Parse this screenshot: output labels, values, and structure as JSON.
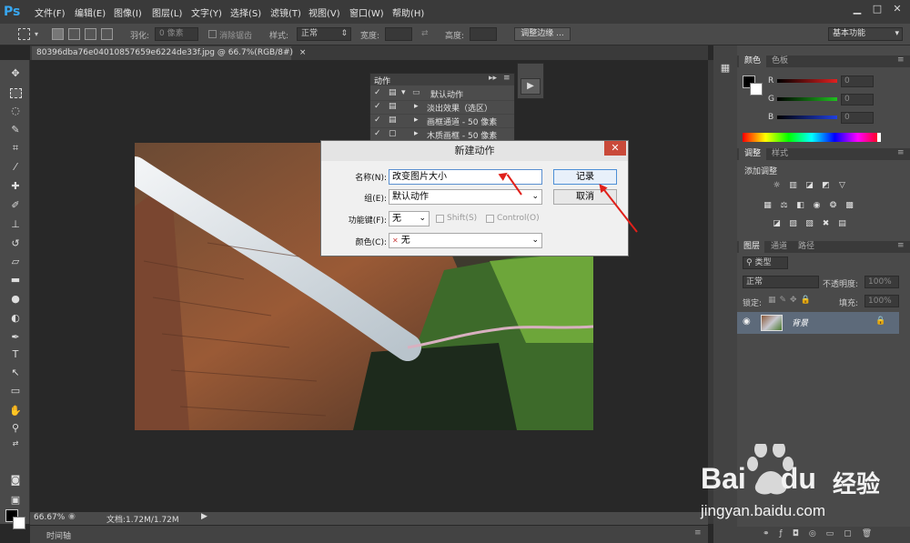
{
  "menubar": {
    "logo": "Ps",
    "items": [
      "文件(F)",
      "编辑(E)",
      "图像(I)",
      "图层(L)",
      "文字(Y)",
      "选择(S)",
      "滤镜(T)",
      "视图(V)",
      "窗口(W)",
      "帮助(H)"
    ]
  },
  "options": {
    "feather_label": "羽化:",
    "feather_value": "0 像素",
    "antialias_label": "消除锯齿",
    "style_label": "样式:",
    "style_value": "正常",
    "width_label": "宽度:",
    "height_label": "高度:",
    "refine_button": "调整边缘 ...",
    "workspace": "基本功能"
  },
  "document": {
    "tab_title": "80396dba76e04010857659e6224de33f.jpg @ 66.7%(RGB/8#)",
    "close": "×"
  },
  "status": {
    "zoom": "66.67%",
    "doc_info": "文档:1.72M/1.72M"
  },
  "timeline": {
    "label": "时间轴"
  },
  "actions_panel": {
    "title": "动作",
    "rows": [
      {
        "label": "默认动作",
        "type": "set"
      },
      {
        "label": "淡出效果（选区）",
        "type": "action"
      },
      {
        "label": "画框通道 - 50 像素",
        "type": "action"
      },
      {
        "label": "木质画框 - 50 像素",
        "type": "action"
      }
    ]
  },
  "dialog": {
    "title": "新建动作",
    "close": "✕",
    "name_label": "名称(N):",
    "name_value": "改变图片大小",
    "group_label": "组(E):",
    "group_value": "默认动作",
    "fkey_label": "功能键(F):",
    "fkey_value": "无",
    "shift_label": "Shift(S)",
    "control_label": "Control(O)",
    "color_label": "颜色(C):",
    "color_value": "无",
    "record_button": "记录",
    "cancel_button": "取消"
  },
  "color_panel": {
    "tabs": [
      "颜色",
      "色板"
    ],
    "channels": [
      "R",
      "G",
      "B"
    ],
    "values": [
      "0",
      "0",
      "0"
    ],
    "channel_colors": [
      "#e02020",
      "#20c020",
      "#2040e0"
    ]
  },
  "adjust_panel": {
    "tabs": [
      "调整",
      "样式"
    ],
    "add_label": "添加调整"
  },
  "layers_panel": {
    "tabs": [
      "图层",
      "通道",
      "路径"
    ],
    "kind": "类型",
    "blend": "正常",
    "opacity_label": "不透明度:",
    "opacity": "100%",
    "lock_label": "锁定:",
    "fill_label": "填充:",
    "fill": "100%",
    "layer_name": "背景"
  },
  "watermark": {
    "brand": "Bai",
    "brand2": "du",
    "suffix": "经验",
    "url": "jingyan.baidu.com"
  }
}
